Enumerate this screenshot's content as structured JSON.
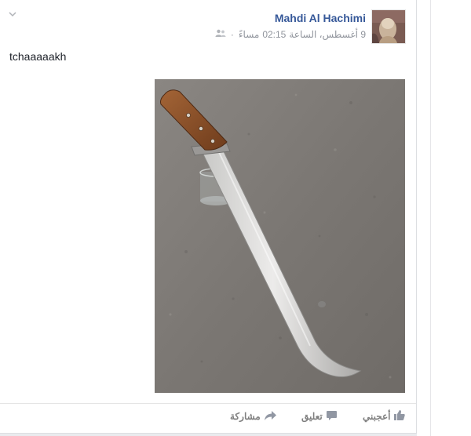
{
  "post": {
    "author": "Mahdi Al Hachimi",
    "date": "9 أغسطس، الساعة",
    "time": "02:15",
    "period": "مساءً",
    "separator": "·",
    "text": "tchaaaaakh"
  },
  "icons": {
    "menu": "chevron-down-icon",
    "audience": "friends-icon",
    "like": "thumbs-up-icon",
    "comment": "comment-icon",
    "share": "share-arrow-icon"
  },
  "actions": {
    "like": "أعجبني",
    "comment": "تعليق",
    "share": "مشاركة"
  },
  "colors": {
    "author_link": "#365899",
    "meta_text": "#90949c",
    "action_text": "#7f7f7f"
  }
}
